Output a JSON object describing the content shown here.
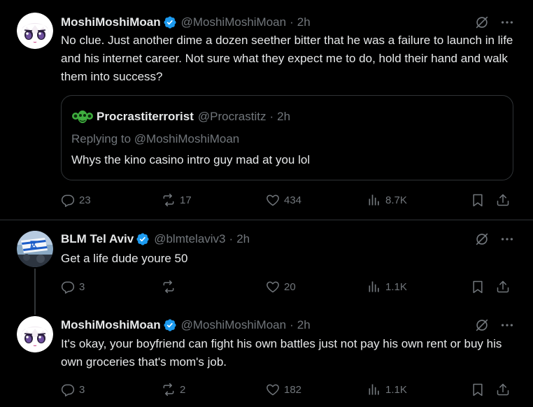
{
  "colors": {
    "background": "#000000",
    "text": "#e7e9ea",
    "muted": "#71767b",
    "verified": "#1d9bf0",
    "border": "#2f3336"
  },
  "tweets": [
    {
      "name": "MoshiMoshiMoan",
      "handle": "@MoshiMoshiMoan",
      "dot": "·",
      "time": "2h",
      "verified": true,
      "text": "No clue.  Just another dime a dozen seether bitter that he was a failure to launch in life and his internet career.  Not sure what they expect me to do, hold their hand and walk them into success?",
      "quote": {
        "name": "Procrastiterrorist",
        "handle": "@Procrastitz",
        "dot": "·",
        "time": "2h",
        "replying_to": "Replying to @MoshiMoshiMoan",
        "text": "Whys the kino casino intro guy mad at you lol"
      },
      "replies": "23",
      "reposts": "17",
      "likes": "434",
      "views": "8.7K"
    },
    {
      "name": "BLM Tel Aviv",
      "handle": "@blmtelaviv3",
      "dot": "·",
      "time": "2h",
      "verified": true,
      "text": "Get a life dude youre 50",
      "replies": "3",
      "reposts": "",
      "likes": "20",
      "views": "1.1K"
    },
    {
      "name": "MoshiMoshiMoan",
      "handle": "@MoshiMoshiMoan",
      "dot": "·",
      "time": "2h",
      "verified": true,
      "text": "It's okay, your boyfriend can fight his own battles just not pay his own rent or buy his own groceries that's mom's job.",
      "replies": "3",
      "reposts": "2",
      "likes": "182",
      "views": "1.1K"
    }
  ]
}
